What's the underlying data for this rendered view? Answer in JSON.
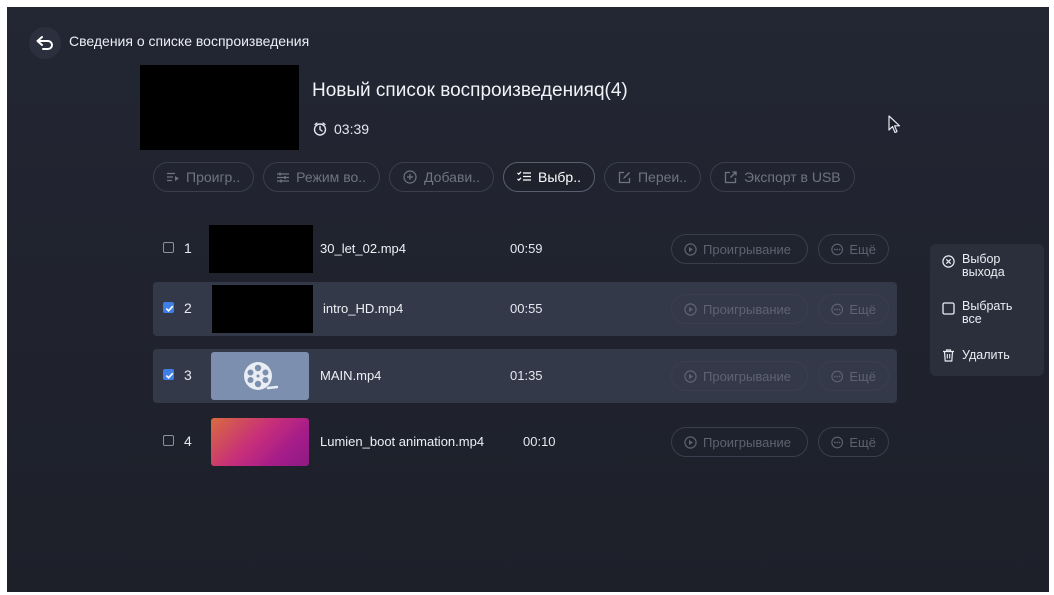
{
  "header": {
    "title": "Сведения о списке воспроизведения"
  },
  "playlist": {
    "title": "Новый список воспроизведенияq(4)",
    "duration": "03:39"
  },
  "toolbar": [
    {
      "label": "Проигр..",
      "icon": "play-list-icon",
      "active": false
    },
    {
      "label": "Режим во..",
      "icon": "sliders-icon",
      "active": false
    },
    {
      "label": "Добави..",
      "icon": "plus-circle-icon",
      "active": false
    },
    {
      "label": "Выбр..",
      "icon": "checklist-icon",
      "active": true
    },
    {
      "label": "Переи..",
      "icon": "edit-icon",
      "active": false
    },
    {
      "label": "Экспорт в USB",
      "icon": "export-icon",
      "active": false
    }
  ],
  "items": [
    {
      "num": "1",
      "name": "30_let_02.mp4",
      "time": "00:59",
      "checked": false,
      "thumb": "black"
    },
    {
      "num": "2",
      "name": "intro_HD.mp4",
      "time": "00:55",
      "checked": true,
      "thumb": "black"
    },
    {
      "num": "3",
      "name": "MAIN.mp4",
      "time": "01:35",
      "checked": true,
      "thumb": "film-reel-icon"
    },
    {
      "num": "4",
      "name": "Lumien_boot animation.mp4",
      "time": "00:10",
      "checked": false,
      "thumb": "gradient"
    }
  ],
  "row_actions": {
    "play_label": "Проигрывание",
    "more_label": "Ещё"
  },
  "selection_menu": {
    "exit_line1": "Выбор",
    "exit_line2": "выхода",
    "select_all_line1": "Выбрать",
    "select_all_line2": "все",
    "delete": "Удалить"
  },
  "colors": {
    "background": "#1f222c",
    "selected_row": "#343949",
    "checkbox_on": "#3e7ee6"
  }
}
